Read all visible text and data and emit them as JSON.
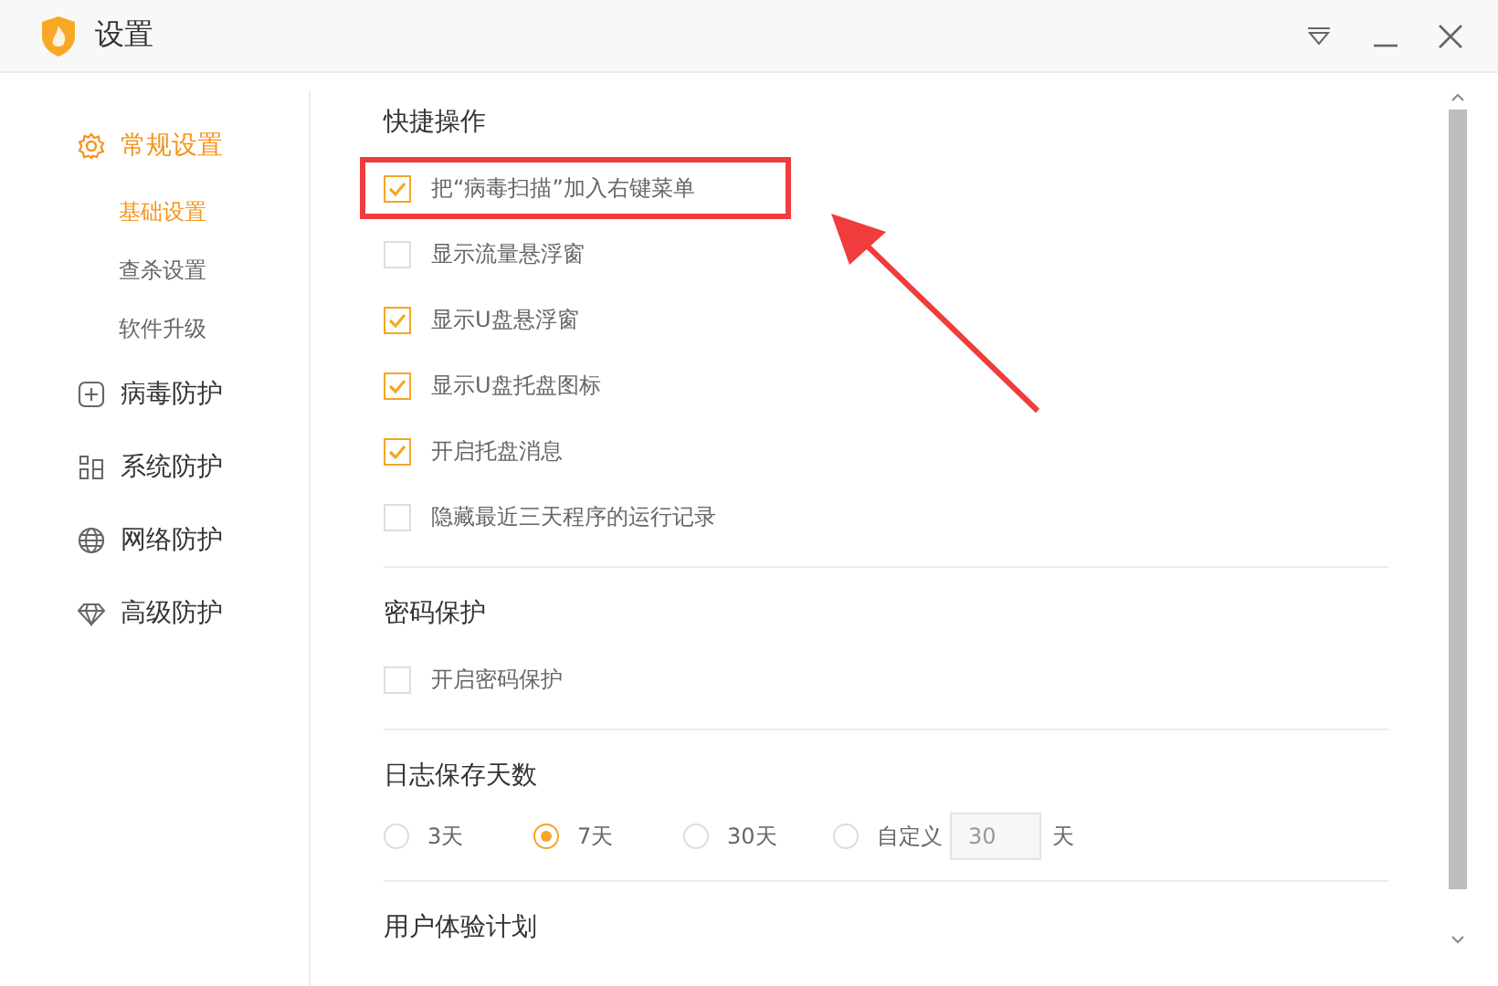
{
  "window": {
    "title": "设置"
  },
  "sidebar": {
    "items": [
      {
        "label": "常规设置",
        "selected": true,
        "children": [
          {
            "label": "基础设置",
            "selected": true
          },
          {
            "label": "查杀设置",
            "selected": false
          },
          {
            "label": "软件升级",
            "selected": false
          }
        ]
      },
      {
        "label": "病毒防护",
        "selected": false
      },
      {
        "label": "系统防护",
        "selected": false
      },
      {
        "label": "网络防护",
        "selected": false
      },
      {
        "label": "高级防护",
        "selected": false
      }
    ]
  },
  "sections": [
    {
      "title": "快捷操作",
      "kind": "checkboxes",
      "items": [
        {
          "label": "把“病毒扫描”加入右键菜单",
          "checked": true,
          "highlighted": true
        },
        {
          "label": "显示流量悬浮窗",
          "checked": false,
          "highlighted": false
        },
        {
          "label": "显示U盘悬浮窗",
          "checked": true,
          "highlighted": false
        },
        {
          "label": "显示U盘托盘图标",
          "checked": true,
          "highlighted": false
        },
        {
          "label": "开启托盘消息",
          "checked": true,
          "highlighted": false
        },
        {
          "label": "隐藏最近三天程序的运行记录",
          "checked": false,
          "highlighted": false
        }
      ]
    },
    {
      "title": "密码保护",
      "kind": "checkboxes",
      "items": [
        {
          "label": "开启密码保护",
          "checked": false,
          "highlighted": false
        }
      ]
    },
    {
      "title": "日志保存天数",
      "kind": "radios",
      "options": [
        {
          "label": "3天",
          "selected": false
        },
        {
          "label": "7天",
          "selected": true
        },
        {
          "label": "30天",
          "selected": false
        },
        {
          "label": "自定义",
          "selected": false,
          "value": "30",
          "suffix": "天"
        }
      ]
    },
    {
      "title": "用户体验计划",
      "kind": "heading"
    }
  ]
}
